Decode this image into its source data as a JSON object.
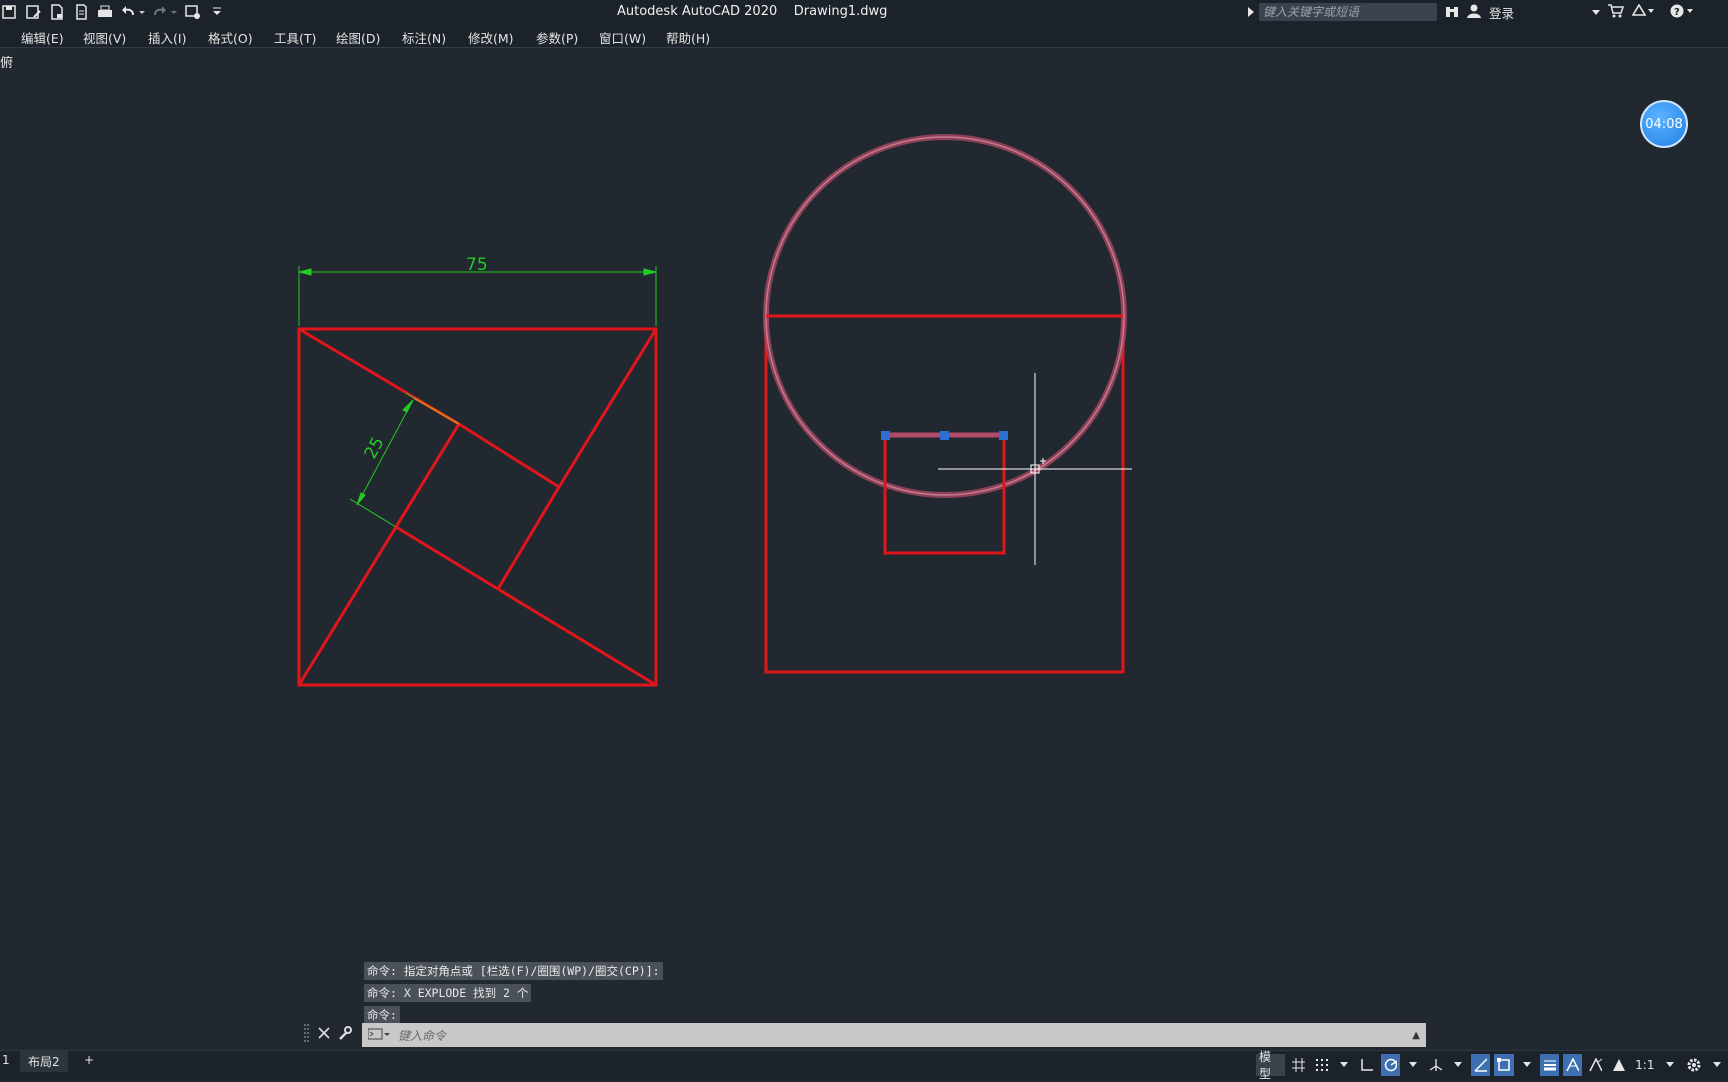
{
  "app": {
    "title": "Autodesk AutoCAD 2020    Drawing1.dwg",
    "search_placeholder": "键入关键字或短语",
    "login_label": "登录"
  },
  "menu": [
    "编辑(E)",
    "视图(V)",
    "插入(I)",
    "格式(O)",
    "工具(T)",
    "绘图(D)",
    "标注(N)",
    "修改(M)",
    "参数(P)",
    "窗口(W)",
    "帮助(H)"
  ],
  "viewport_label": "俯",
  "timer": "04:08",
  "drawing": {
    "dim_top": "75",
    "dim_inner": "25",
    "line_color": "#e0161b",
    "dim_color": "#22cc22",
    "grip_color": "#2e6fd6",
    "highlight_color": "#b04a66"
  },
  "command": {
    "history": [
      "命令: 指定对角点或 [栏选(F)/圈围(WP)/圈交(CP)]:",
      "命令: X EXPLODE 找到 2 个",
      "命令:"
    ],
    "placeholder": "键入命令"
  },
  "tabs": [
    "1",
    "布局2"
  ],
  "status": {
    "model_label": "模型",
    "scale_label": "1:1"
  }
}
